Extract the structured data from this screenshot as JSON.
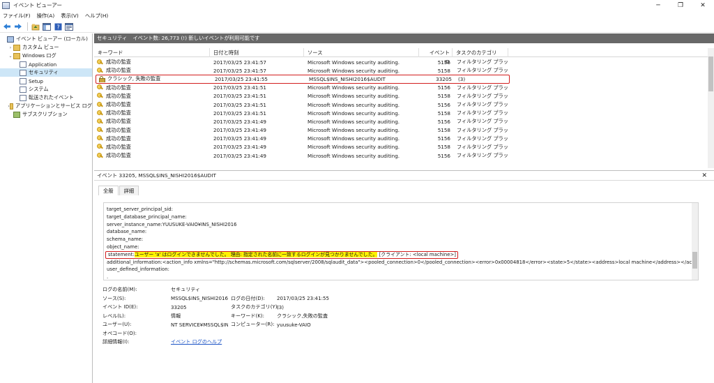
{
  "window": {
    "title": "イベント ビューアー"
  },
  "menu": [
    "ファイル(F)",
    "操作(A)",
    "表示(V)",
    "ヘルプ(H)"
  ],
  "tree": [
    {
      "label": "イベント ビューアー (ローカル)",
      "indent": 0,
      "icon": "pc",
      "arrow": ""
    },
    {
      "label": "カスタム ビュー",
      "indent": 1,
      "icon": "folder",
      "arrow": "›"
    },
    {
      "label": "Windows ログ",
      "indent": 1,
      "icon": "folder",
      "arrow": "⌄"
    },
    {
      "label": "Application",
      "indent": 2,
      "icon": "log",
      "arrow": ""
    },
    {
      "label": "セキュリティ",
      "indent": 2,
      "icon": "log",
      "arrow": "",
      "selected": true
    },
    {
      "label": "Setup",
      "indent": 2,
      "icon": "log",
      "arrow": ""
    },
    {
      "label": "システム",
      "indent": 2,
      "icon": "log",
      "arrow": ""
    },
    {
      "label": "転送されたイベント",
      "indent": 2,
      "icon": "log",
      "arrow": ""
    },
    {
      "label": "アプリケーションとサービス ログ",
      "indent": 1,
      "icon": "folder",
      "arrow": "›"
    },
    {
      "label": "サブスクリプション",
      "indent": 1,
      "icon": "sub",
      "arrow": ""
    }
  ],
  "list": {
    "log_name": "セキュリティ",
    "count_text": "イベント数: 26,773 (!) 新しいイベントが利用可能です",
    "columns": [
      "キーワード",
      "日付と時刻",
      "ソース",
      "イベント ID",
      "タスクのカテゴリ"
    ],
    "rows": [
      {
        "keyword": "成功の監査",
        "datetime": "2017/03/25 23:41:57",
        "source": "Microsoft Windows security auditing.",
        "id": "5156",
        "category": "フィルタリング プラット..."
      },
      {
        "keyword": "成功の監査",
        "datetime": "2017/03/25 23:41:57",
        "source": "Microsoft Windows security auditing.",
        "id": "5158",
        "category": "フィルタリング プラット..."
      },
      {
        "keyword": "クラシック, 失敗の監査",
        "datetime": "2017/03/25 23:41:55",
        "source": "MSSQL$INS_NISHI2016$AUDIT",
        "id": "33205",
        "category": "(3)",
        "highlight": true
      },
      {
        "keyword": "成功の監査",
        "datetime": "2017/03/25 23:41:51",
        "source": "Microsoft Windows security auditing.",
        "id": "5156",
        "category": "フィルタリング プラット..."
      },
      {
        "keyword": "成功の監査",
        "datetime": "2017/03/25 23:41:51",
        "source": "Microsoft Windows security auditing.",
        "id": "5158",
        "category": "フィルタリング プラット..."
      },
      {
        "keyword": "成功の監査",
        "datetime": "2017/03/25 23:41:51",
        "source": "Microsoft Windows security auditing.",
        "id": "5156",
        "category": "フィルタリング プラット..."
      },
      {
        "keyword": "成功の監査",
        "datetime": "2017/03/25 23:41:51",
        "source": "Microsoft Windows security auditing.",
        "id": "5158",
        "category": "フィルタリング プラット..."
      },
      {
        "keyword": "成功の監査",
        "datetime": "2017/03/25 23:41:49",
        "source": "Microsoft Windows security auditing.",
        "id": "5156",
        "category": "フィルタリング プラット..."
      },
      {
        "keyword": "成功の監査",
        "datetime": "2017/03/25 23:41:49",
        "source": "Microsoft Windows security auditing.",
        "id": "5158",
        "category": "フィルタリング プラット..."
      },
      {
        "keyword": "成功の監査",
        "datetime": "2017/03/25 23:41:49",
        "source": "Microsoft Windows security auditing.",
        "id": "5156",
        "category": "フィルタリング プラット..."
      },
      {
        "keyword": "成功の監査",
        "datetime": "2017/03/25 23:41:49",
        "source": "Microsoft Windows security auditing.",
        "id": "5158",
        "category": "フィルタリング プラット..."
      },
      {
        "keyword": "成功の監査",
        "datetime": "2017/03/25 23:41:49",
        "source": "Microsoft Windows security auditing.",
        "id": "5156",
        "category": "フィルタリング プラット..."
      }
    ]
  },
  "detail": {
    "header": "イベント 33205, MSSQL$INS_NISHI2016$AUDIT",
    "close": "✕",
    "tabs": [
      "全般",
      "詳細"
    ],
    "lines": [
      "target_server_principal_sid:",
      "target_database_principal_name:",
      "server_instance_name:YUUSUKE-VAIO¥INS_NISHI2016",
      "database_name:",
      "schema_name:",
      "object_name:"
    ],
    "statement_label": "statement:",
    "statement_yellow": "ユーザー 'a' はログインできませんでした。 理由: 指定された名前に一致するログインが見つかりませんでした。",
    "statement_tail": " [クライアント: <local machine>]",
    "lines_after": [
      "additional_information:<action_info xmlns=\"http://schemas.microsoft.com/sqlserver/2008/sqlaudit_data\"><pooled_connection>0</pooled_connection><error>0x00004818</error><state>5</state><address>local machine</address></action_info>",
      "user_defined_information:",
      "."
    ],
    "props": {
      "log_name_label": "ログの名前(M):",
      "log_name": "セキュリティ",
      "source_label": "ソース(S):",
      "source": "MSSQL$INS_NISHI2016$AUD",
      "logged_label": "ログの日付(D):",
      "logged": "2017/03/25 23:41:55",
      "event_id_label": "イベント ID(E):",
      "event_id": "33205",
      "task_label": "タスクのカテゴリ(Y):",
      "task": "(3)",
      "level_label": "レベル(L):",
      "level": "情報",
      "keywords_label": "キーワード(K):",
      "keywords": "クラシック,失敗の監査",
      "user_label": "ユーザー(U):",
      "user": "NT SERVICE¥MSSQL$INS_NI",
      "computer_label": "コンピューター(R):",
      "computer": "yuusuke-VAIO",
      "opcode_label": "オペコード(O):",
      "more_label": "詳細情報(I):",
      "more_link": "イベント ログのヘルプ"
    }
  }
}
